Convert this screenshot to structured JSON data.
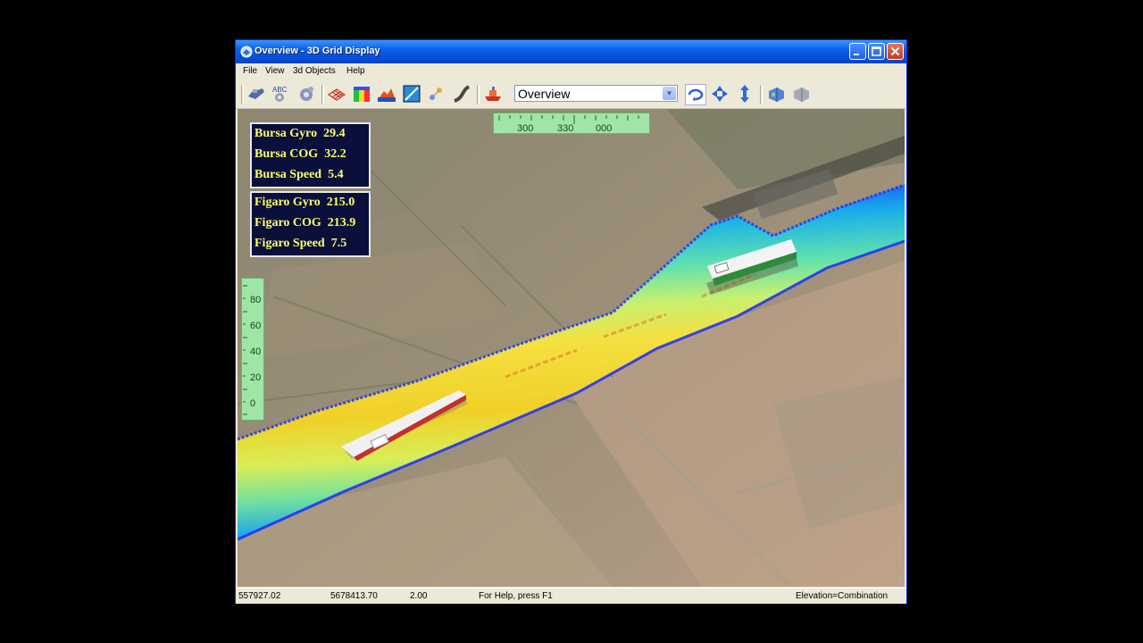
{
  "window": {
    "title": "Overview - 3D Grid Display"
  },
  "menu": [
    "File",
    "View",
    "3d Objects",
    "Help"
  ],
  "toolbar": {
    "buttons": [
      "ship-icon",
      "abc-text-icon",
      "gears-icon",
      "grid-mesh-icon",
      "color-grid-icon",
      "terrain-icon",
      "contour-icon",
      "points-icon",
      "pipeline-icon",
      "vessel-icon"
    ],
    "view_select": "Overview",
    "nav_buttons": [
      "rotate-icon",
      "pan-icon",
      "zoom-vertical-icon",
      "ship-blue-icon",
      "ship-gray-icon"
    ]
  },
  "hud": {
    "bursa": [
      {
        "label": "Bursa Gyro",
        "value": "29.4"
      },
      {
        "label": "Bursa COG",
        "value": "32.2"
      },
      {
        "label": "Bursa Speed",
        "value": "5.4"
      }
    ],
    "figaro": [
      {
        "label": "Figaro Gyro",
        "value": "215.0"
      },
      {
        "label": "Figaro COG",
        "value": "213.9"
      },
      {
        "label": "Figaro Speed",
        "value": "7.5"
      }
    ]
  },
  "compass": [
    "300",
    "330",
    "000"
  ],
  "depth_scale": [
    "80",
    "60",
    "40",
    "20",
    "0"
  ],
  "status": {
    "x": "557927.02",
    "y": "5678413.70",
    "scale": "2.00",
    "help": "For Help, press F1",
    "mode": "Elevation=Combination"
  },
  "colors": {
    "title_bar": "#0a5fe8",
    "hud_bg": "#0a0f3c",
    "hud_text": "#ffff66",
    "scale_bg": "#9fe6a6"
  }
}
